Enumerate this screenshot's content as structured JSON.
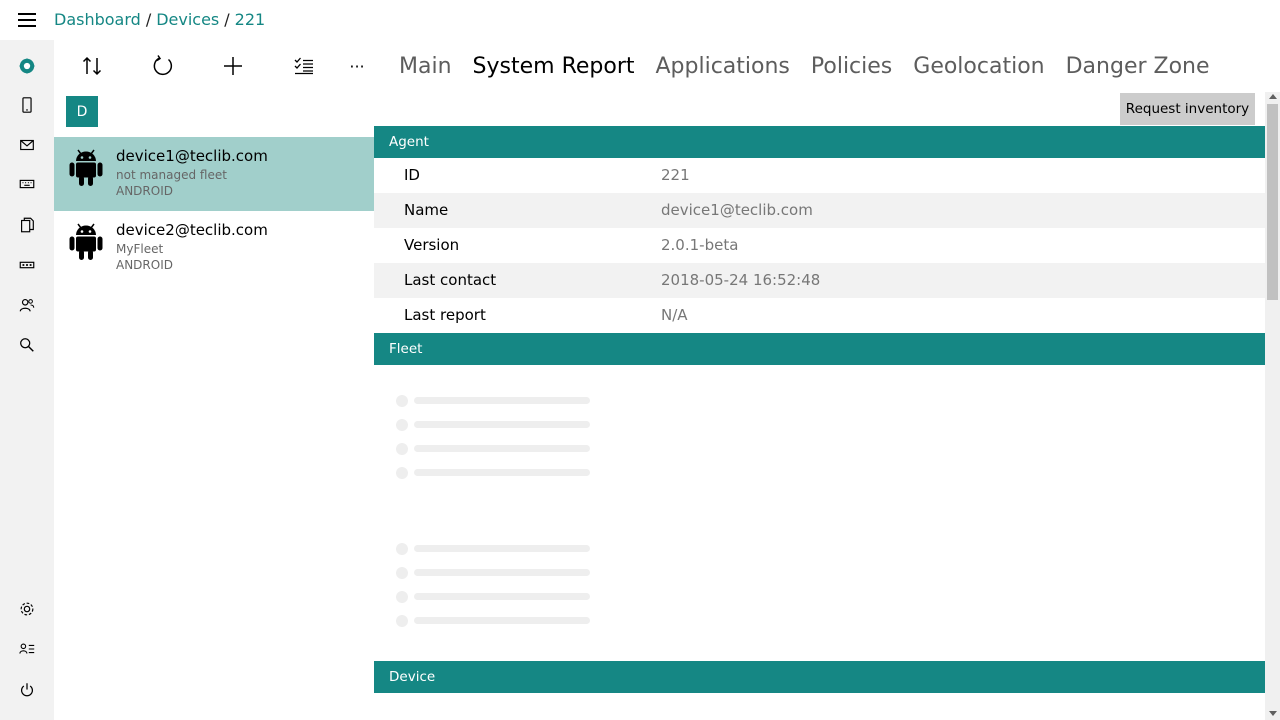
{
  "breadcrumb": {
    "item1": "Dashboard",
    "item2": "Devices",
    "item3": "221",
    "separator": "/"
  },
  "nav": {
    "icons": [
      "menu-icon",
      "flyve-logo-icon",
      "device-icon",
      "mail-icon",
      "keyboard-icon",
      "files-icon",
      "applications-icon",
      "users-icon",
      "search-icon",
      "settings-icon",
      "user-list-icon",
      "power-icon"
    ]
  },
  "toolbar": {
    "icons": [
      "sort-icon",
      "refresh-icon",
      "add-icon",
      "select-list-icon",
      "more-icon"
    ],
    "more_label": "···"
  },
  "list": {
    "letter": "D",
    "devices": [
      {
        "name": "device1@teclib.com",
        "fleet": "not managed fleet",
        "os": "ANDROID"
      },
      {
        "name": "device2@teclib.com",
        "fleet": "MyFleet",
        "os": "ANDROID"
      }
    ]
  },
  "tabs": [
    "Main",
    "System Report",
    "Applications",
    "Policies",
    "Geolocation",
    "Danger Zone"
  ],
  "active_tab": "System Report",
  "request_inventory_label": "Request inventory",
  "sections": {
    "agent": "Agent",
    "fleet": "Fleet",
    "device": "Device"
  },
  "agent": [
    {
      "key": "ID",
      "value": "221"
    },
    {
      "key": "Name",
      "value": "device1@teclib.com"
    },
    {
      "key": "Version",
      "value": "2.0.1-beta"
    },
    {
      "key": "Last contact",
      "value": "2018-05-24 16:52:48"
    },
    {
      "key": "Last report",
      "value": "N/A"
    }
  ],
  "colors": {
    "accent": "#158784",
    "selected_row": "#a1cfcb",
    "sidebar_bg": "#f2f2f2",
    "button_bg": "#cccccc"
  }
}
